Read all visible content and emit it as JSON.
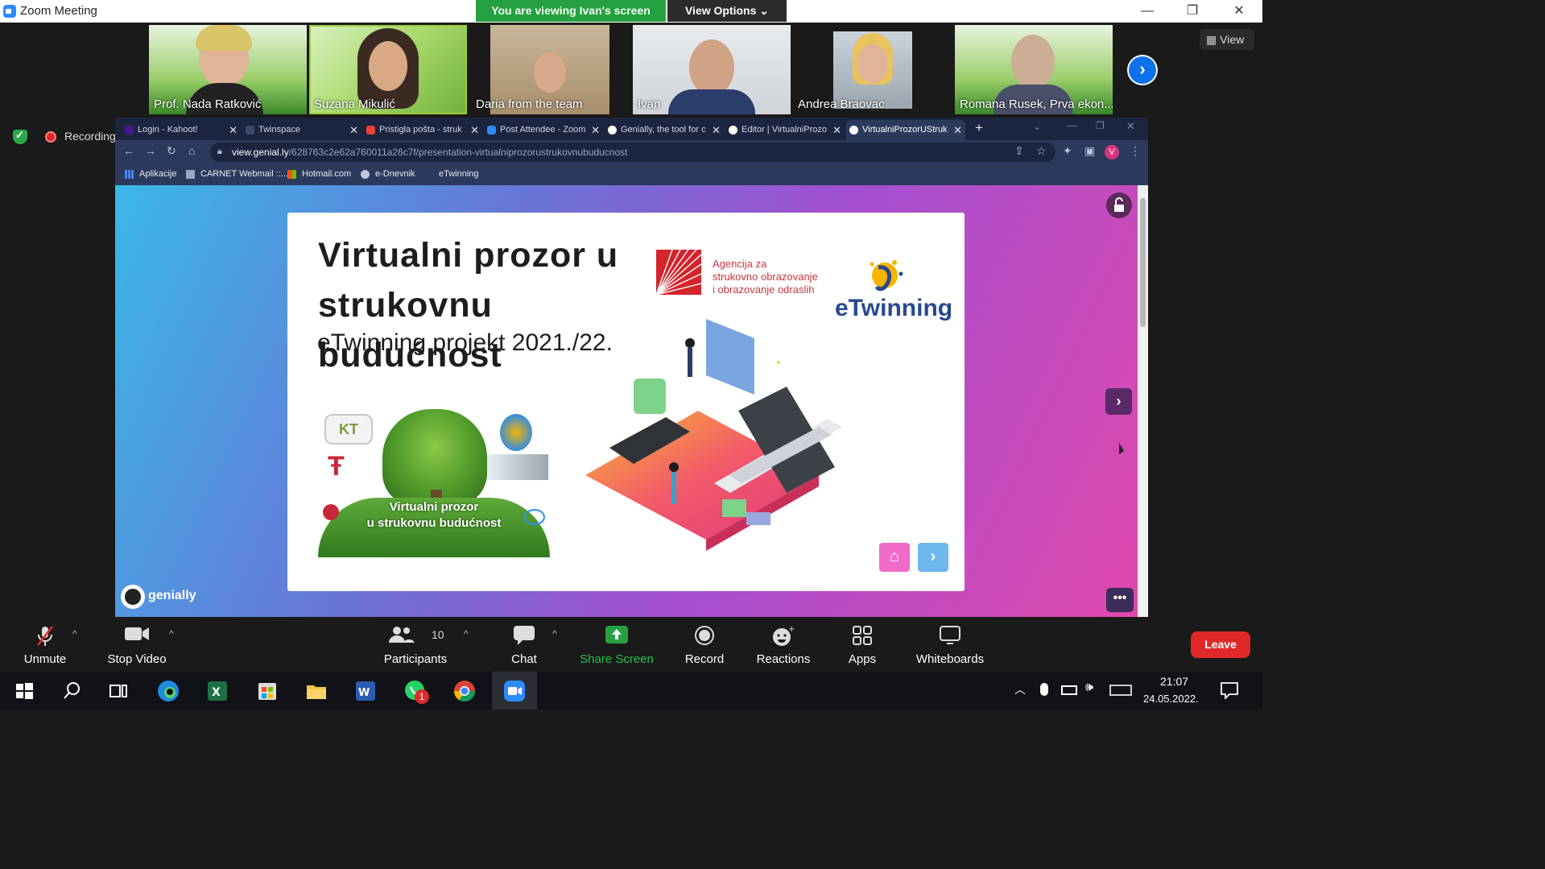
{
  "window": {
    "title": "Zoom Meeting",
    "minimize": "—",
    "restore": "❐",
    "close": "✕"
  },
  "banner": {
    "viewing": "You are viewing Ivan's screen",
    "view_options": "View Options ⌄"
  },
  "participants": [
    {
      "name": "Prof. Nada Ratković"
    },
    {
      "name": "Suzana Mikulić"
    },
    {
      "name": "Daria from the team"
    },
    {
      "name": "Ivan"
    },
    {
      "name": "Andrea Braovac"
    },
    {
      "name": "Romana Rusek, Prva ekon..."
    }
  ],
  "view_button": "View",
  "recording": "Recording",
  "browser": {
    "tabs": [
      {
        "label": "Login - Kahoot!",
        "color": "#46178f"
      },
      {
        "label": "Twinspace",
        "color": "#2b3a5c"
      },
      {
        "label": "Pristigla pošta - struk",
        "color": "#ea4335"
      },
      {
        "label": "Post Attendee - Zoom",
        "color": "#2d8cff"
      },
      {
        "label": "Genially, the tool for c",
        "color": "#ffffff"
      },
      {
        "label": "Editor | VirtualniProzo",
        "color": "#ffffff"
      },
      {
        "label": "VirtualniProzorUStruk",
        "color": "#ffffff"
      }
    ],
    "new_tab": "+",
    "url_domain": "view.genial.ly",
    "url_path": "/628763c2e62a760011a26c7f/presentation-virtualniprozorustrukovnubuducnost",
    "bookmarks": [
      "Aplikacije",
      "CARNET Webmail ::...",
      "Hotmail.com",
      "e-Dnevnik",
      "eTwinning"
    ]
  },
  "slide": {
    "title_line1": "Virtualni prozor u",
    "title_line2": "strukovnu budućnost",
    "subtitle": "eTwinning projekt 2021./22.",
    "agency_line1": "Agencija za",
    "agency_line2": "strukovno obrazovanje",
    "agency_line3": "i obrazovanje odraslih",
    "etwinning": "eTwinning",
    "poster_line1": "Virtualni prozor",
    "poster_line2": "u strukovnu budućnost",
    "brand": "genially"
  },
  "controls": {
    "unmute": "Unmute",
    "stop_video": "Stop Video",
    "participants": "Participants",
    "participants_count": "10",
    "chat": "Chat",
    "share_screen": "Share Screen",
    "record": "Record",
    "reactions": "Reactions",
    "apps": "Apps",
    "whiteboards": "Whiteboards",
    "leave": "Leave"
  },
  "taskbar": {
    "time": "21:07",
    "date": "24.05.2022.",
    "whatsapp_badge": "1"
  },
  "colors": {
    "share_green": "#26a141",
    "leave_red": "#e02828",
    "zoom_blue": "#2d8cff",
    "slide_pink": "#f06ac8"
  }
}
